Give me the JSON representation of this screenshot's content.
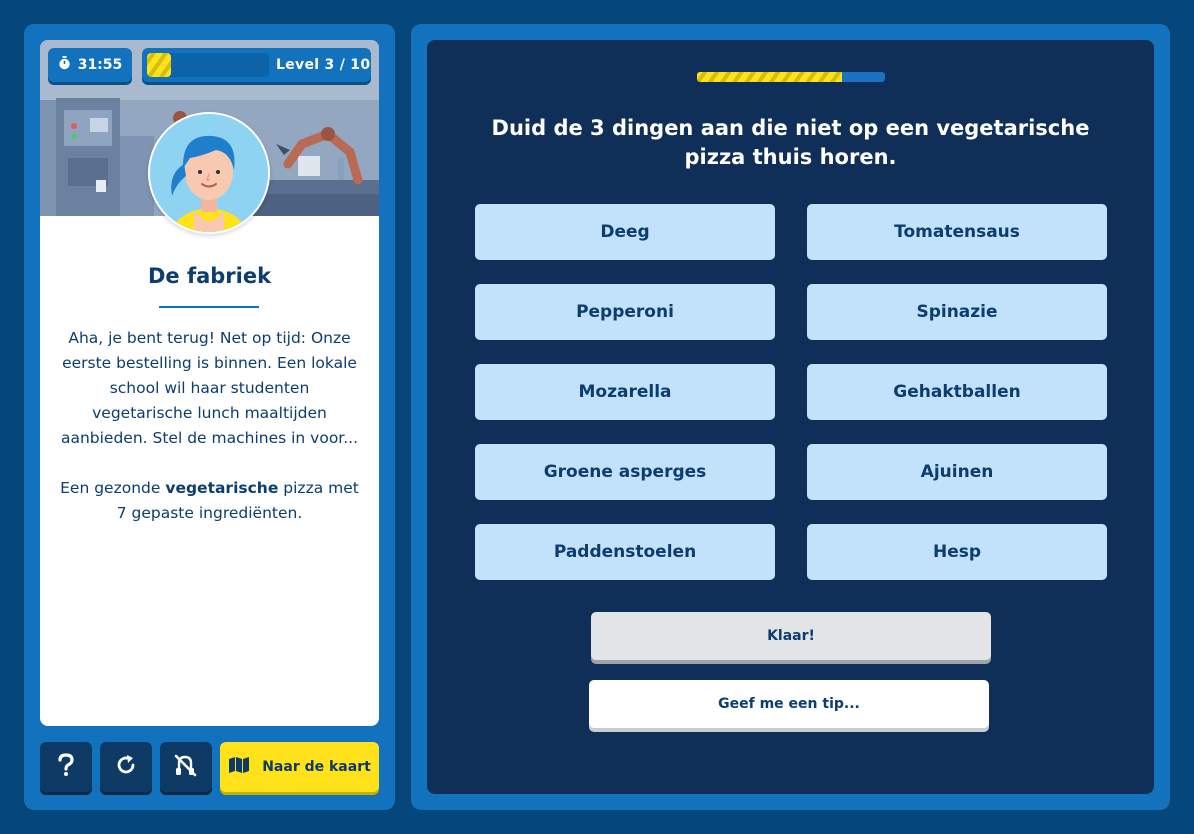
{
  "hud": {
    "timer": "31:55",
    "level_label": "Level 3 / 10",
    "level_progress": 0.2
  },
  "story": {
    "title": "De fabriek",
    "paragraph_1": "Aha, je bent terug! Net op tijd: Onze eerste bestelling is binnen. Een lokale school wil haar studenten vegetarische lunch maaltijden aanbieden. Stel de machines in voor...",
    "paragraph_2_pre": "Een gezonde ",
    "paragraph_2_bold": "vegetarische",
    "paragraph_2_post": " pizza met 7 gepaste ingrediënten."
  },
  "controls": {
    "help_icon": "question-mark-icon",
    "restart_icon": "restart-icon",
    "sound_icon": "sound-off-icon",
    "map_icon": "map-icon",
    "map_label": "Naar de kaart"
  },
  "quiz": {
    "progress": 0.77,
    "question": "Duid de 3 dingen aan die niet op een vegetarische pizza thuis horen.",
    "options": [
      "Deeg",
      "Tomatensaus",
      "Pepperoni",
      "Spinazie",
      "Mozarella",
      "Gehaktballen",
      "Groene asperges",
      "Ajuinen",
      "Paddenstoelen",
      "Hesp"
    ],
    "done_label": "Klaar!",
    "tip_label": "Geef me een tip..."
  },
  "colors": {
    "background": "#06477b",
    "frame": "#1372bd",
    "panel": "#0f2f59",
    "option": "#c2e1fb",
    "accent_yellow": "#ffe21a",
    "text_dark": "#0b3d6e"
  }
}
